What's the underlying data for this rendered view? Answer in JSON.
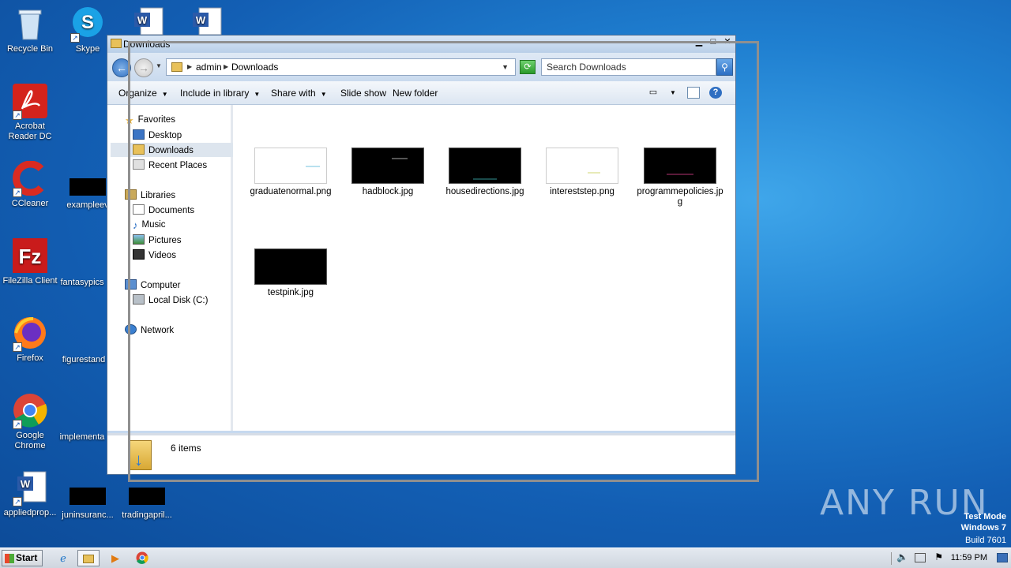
{
  "desktop": {
    "icons": [
      {
        "label": "Recycle Bin",
        "icon": "recycle-bin-icon"
      },
      {
        "label": "Skype",
        "icon": "skype-icon"
      },
      {
        "label": "Acrobat Reader DC",
        "icon": "acrobat-icon"
      },
      {
        "label": "CCleaner",
        "icon": "ccleaner-icon"
      },
      {
        "label": "exampleev",
        "icon": "file-icon"
      },
      {
        "label": "FileZilla Client",
        "icon": "filezilla-icon"
      },
      {
        "label": "fantasypics",
        "icon": "file-icon"
      },
      {
        "label": "Firefox",
        "icon": "firefox-icon"
      },
      {
        "label": "figurestand",
        "icon": "file-icon"
      },
      {
        "label": "Google Chrome",
        "icon": "chrome-icon"
      },
      {
        "label": "implementa",
        "icon": "file-icon"
      },
      {
        "label": "appliedprop...",
        "icon": "word-doc-icon"
      },
      {
        "label": "juninsuranc...",
        "icon": "file-icon"
      },
      {
        "label": "tradingapril...",
        "icon": "file-icon"
      }
    ]
  },
  "window": {
    "title": "Downloads",
    "breadcrumb": [
      "admin",
      "Downloads"
    ],
    "search_placeholder": "Search Downloads",
    "commands": [
      "Organize",
      "Include in library",
      "Share with",
      "Slide show",
      "New folder"
    ],
    "nav": {
      "favorites": "Favorites",
      "desktop": "Desktop",
      "downloads": "Downloads",
      "recent": "Recent Places",
      "libraries": "Libraries",
      "documents": "Documents",
      "music": "Music",
      "pictures": "Pictures",
      "videos": "Videos",
      "computer": "Computer",
      "local_disk": "Local Disk (C:)",
      "network": "Network"
    },
    "files": [
      {
        "name": "graduatenormal.png",
        "thumb": "white"
      },
      {
        "name": "hadblock.jpg",
        "thumb": "black"
      },
      {
        "name": "housedirections.jpg",
        "thumb": "black"
      },
      {
        "name": "intereststep.png",
        "thumb": "white"
      },
      {
        "name": "programmepolicies.jpg",
        "thumb": "black"
      },
      {
        "name": "testpink.jpg",
        "thumb": "black"
      }
    ],
    "status": "6 items"
  },
  "taskbar": {
    "start": "Start",
    "clock": "11:59 PM"
  },
  "watermark": {
    "line1": "Test Mode",
    "line2": "Windows 7",
    "line3": "Build 7601",
    "brand": "ANY RUN"
  },
  "colors": {
    "desktop_blue": "#1f7fd0",
    "window_frame": "#c6d9ef",
    "selection": "#dde5ee"
  }
}
